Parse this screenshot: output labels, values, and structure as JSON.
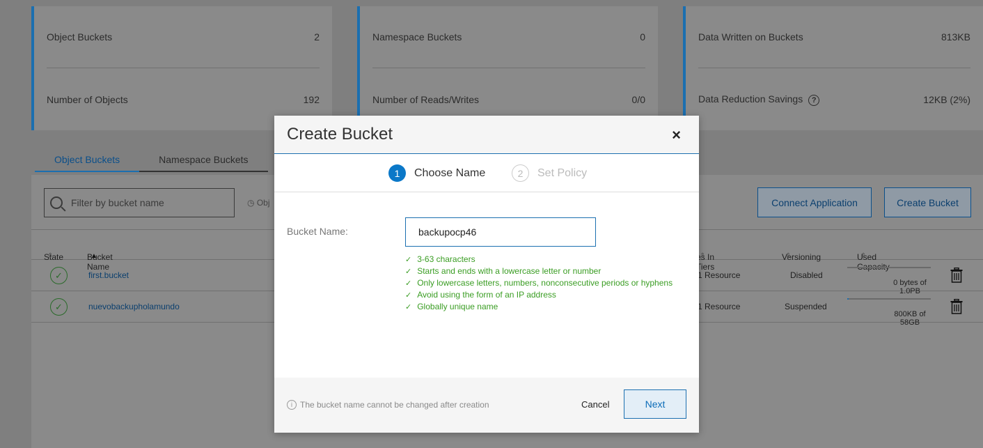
{
  "stats": {
    "card1": {
      "label1": "Object Buckets",
      "value1": "2",
      "label2": "Number of Objects",
      "value2": "192"
    },
    "card2": {
      "label1": "Namespace Buckets",
      "value1": "0",
      "label2": "Number of Reads/Writes",
      "value2": "0/0"
    },
    "card3": {
      "label1": "Data Written on Buckets",
      "value1": "813KB",
      "label2": "Data Reduction Savings",
      "help": "?",
      "value2": "12KB (2%)"
    }
  },
  "tabs": [
    {
      "label": "Object Buckets",
      "active": true
    },
    {
      "label": "Namespace Buckets",
      "active": false
    }
  ],
  "toolbar": {
    "filter_placeholder": "Filter by bucket name",
    "obj_hint": "Obj",
    "connect_label": "Connect Application",
    "create_label": "Create Bucket"
  },
  "table": {
    "headers": {
      "state": "State",
      "name": "Bucket Name",
      "tiers": "es In Tiers",
      "versioning": "Versioning",
      "capacity": "Used Capacity"
    },
    "rows": [
      {
        "name": "first.bucket",
        "tiers": "1 Resource",
        "versioning": "Disabled",
        "capacity": "0 bytes of 1.0PB",
        "used_fraction": 0.0
      },
      {
        "name": "nuevobackupholamundo",
        "tiers": "1 Resource",
        "versioning": "Suspended",
        "capacity": "800KB of 58GB",
        "used_fraction": 0.02
      }
    ]
  },
  "modal": {
    "title": "Create Bucket",
    "close": "×",
    "steps": [
      {
        "num": "1",
        "label": "Choose Name"
      },
      {
        "num": "2",
        "label": "Set Policy"
      }
    ],
    "field_label": "Bucket Name:",
    "field_value": "backupocp46",
    "rules": [
      "3-63 characters",
      "Starts and ends with a lowercase letter or number",
      "Only lowercase letters, numbers, nonconsecutive periods or hyphens",
      "Avoid using the form of an IP address",
      "Globally unique name"
    ],
    "footer_info_glyph": "i",
    "footer_note": "The bucket name cannot be changed after creation",
    "cancel_label": "Cancel",
    "next_label": "Next"
  },
  "colors": {
    "accent": "#1b6fb0",
    "success": "#3a9d23",
    "overlay": "#7f7f7f"
  }
}
